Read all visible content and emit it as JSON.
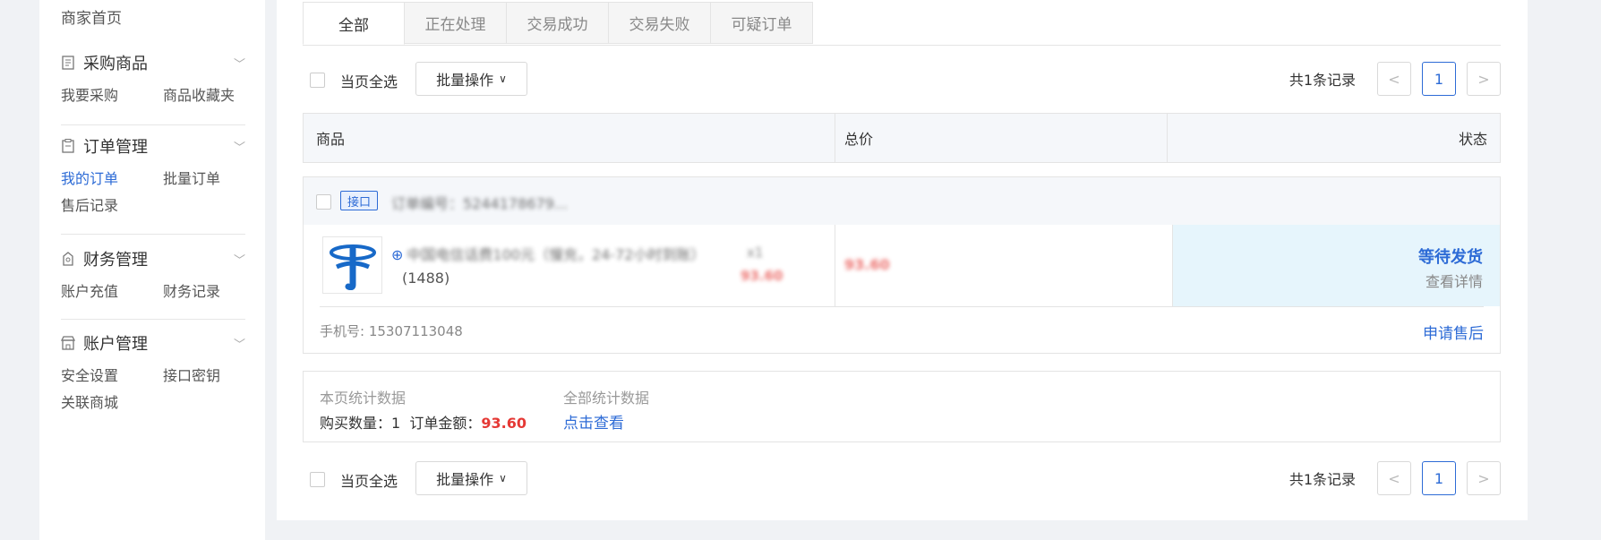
{
  "sidebar": {
    "home": "商家首页",
    "groups": [
      {
        "title": "采购商品",
        "icon": "document-icon",
        "links": [
          {
            "label": "我要采购",
            "active": false
          },
          {
            "label": "商品收藏夹",
            "active": false
          }
        ]
      },
      {
        "title": "订单管理",
        "icon": "clipboard-icon",
        "links": [
          {
            "label": "我的订单",
            "active": true
          },
          {
            "label": "批量订单",
            "active": false
          },
          {
            "label": "售后记录",
            "active": false
          }
        ]
      },
      {
        "title": "财务管理",
        "icon": "wallet-icon",
        "links": [
          {
            "label": "账户充值",
            "active": false
          },
          {
            "label": "财务记录",
            "active": false
          }
        ]
      },
      {
        "title": "账户管理",
        "icon": "store-icon",
        "links": [
          {
            "label": "安全设置",
            "active": false
          },
          {
            "label": "接口密钥",
            "active": false
          },
          {
            "label": "关联商城",
            "active": false
          }
        ]
      }
    ]
  },
  "tabs": [
    {
      "label": "全部",
      "active": true
    },
    {
      "label": "正在处理",
      "active": false
    },
    {
      "label": "交易成功",
      "active": false
    },
    {
      "label": "交易失败",
      "active": false
    },
    {
      "label": "可疑订单",
      "active": false
    }
  ],
  "toolbar": {
    "select_all": "当页全选",
    "batch": "批量操作",
    "total": "共1条记录",
    "prev": "<",
    "page": "1",
    "next": ">"
  },
  "table_headers": {
    "product": "商品",
    "total_price": "总价",
    "status": "状态"
  },
  "order": {
    "tag": "接口",
    "order_no": "订单编号：5244178679...",
    "product_name": "中国电信话费100元（慢充，24-72小时到账）",
    "product_name_2": "(1488)",
    "qty": "x1",
    "unit_price": "93.60",
    "total_price": "93.60",
    "status": "等待发货",
    "detail_link": "查看详情",
    "phone": "手机号: 15307113048",
    "after_sale": "申请售后"
  },
  "stats": {
    "page_label": "本页统计数据",
    "qty_label": "购买数量：",
    "qty_value": "1",
    "amount_label": "订单金额：",
    "amount_value": "93.60",
    "all_label": "全部统计数据",
    "all_link": "点击查看"
  },
  "colors": {
    "accent": "#2d6bd6",
    "price": "#e53935",
    "status_bg": "#e6f5fc"
  }
}
